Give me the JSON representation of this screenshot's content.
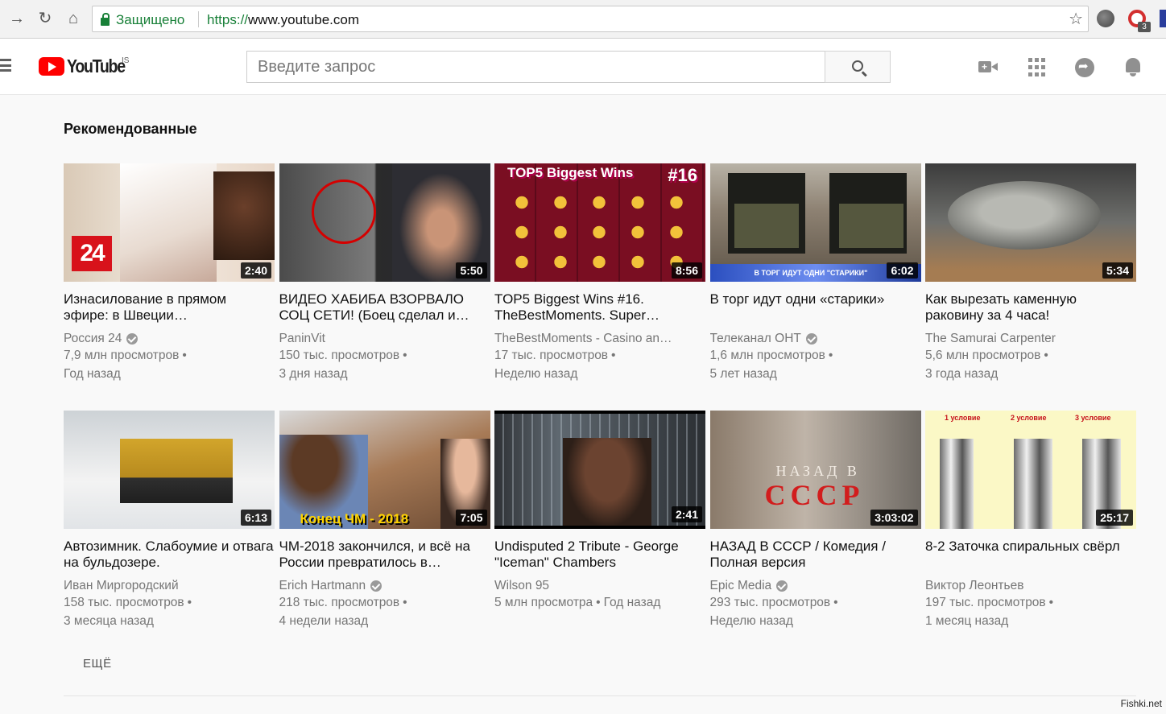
{
  "browser": {
    "secure_label": "Защищено",
    "url_protocol": "https://",
    "url_host": "www.youtube.com",
    "extension_badge": "3"
  },
  "header": {
    "logo_text": "YouTube",
    "country_code": "IS",
    "search_placeholder": "Введите запрос"
  },
  "section": {
    "title": "Рекомендованные",
    "more_label": "ЕЩЁ"
  },
  "videos": [
    {
      "title": "Изнасилование в прямом эфире: в Швеции…",
      "channel": "Россия 24",
      "verified": true,
      "views": "7,9 млн просмотров",
      "age": "Год назад",
      "duration": "2:40",
      "thumb_text": "24"
    },
    {
      "title": "ВИДЕО ХАБИБА ВЗОРВАЛО СОЦ СЕТИ! (Боец сделал и…",
      "channel": "PaninVit",
      "verified": false,
      "views": "150 тыс. просмотров",
      "age": "3 дня назад",
      "duration": "5:50"
    },
    {
      "title": "TOP5 Biggest Wins #16. TheBestMoments. Super…",
      "channel": "TheBestMoments - Casino an…",
      "verified": false,
      "views": "17 тыс. просмотров",
      "age": "Неделю назад",
      "duration": "8:56",
      "thumb_text": "TOP5 Biggest Wins",
      "thumb_num": "#16"
    },
    {
      "title": "В торг идут одни «старики»",
      "channel": "Телеканал ОНТ",
      "verified": true,
      "views": "1,6 млн просмотров",
      "age": "5 лет назад",
      "duration": "6:02",
      "thumb_text": "В ТОРГ ИДУТ ОДНИ \"СТАРИКИ\""
    },
    {
      "title": "Как вырезать каменную раковину за 4 часа!",
      "channel": "The Samurai Carpenter",
      "verified": false,
      "views": "5,6 млн просмотров",
      "age": "3 года назад",
      "duration": "5:34"
    },
    {
      "title": "Автозимник. Слабоумие и отвага на бульдозере.",
      "channel": "Иван Миргородский",
      "verified": false,
      "views": "158 тыс. просмотров",
      "age": "3 месяца назад",
      "duration": "6:13"
    },
    {
      "title": "ЧМ-2018 закончился, и всё на России превратилось в…",
      "channel": "Erich Hartmann",
      "verified": true,
      "views": "218 тыс. просмотров",
      "age": "4 недели назад",
      "duration": "7:05",
      "thumb_text": "Конец ЧМ - 2018"
    },
    {
      "title": "Undisputed 2 Tribute - George \"Iceman\" Chambers",
      "channel": "Wilson 95",
      "verified": false,
      "views": "5 млн просмотра",
      "age": "Год назад",
      "duration": "2:41",
      "inline_age": true
    },
    {
      "title": "НАЗАД В СССР / Комедия / Полная версия",
      "channel": "Epic Media",
      "verified": true,
      "views": "293 тыс. просмотров",
      "age": "Неделю назад",
      "duration": "3:03:02",
      "thumb_text": "НАЗАД В",
      "thumb_text2": "СССР"
    },
    {
      "title": "8-2 Заточка спиральных свёрл",
      "channel": "Виктор Леонтьев",
      "verified": false,
      "views": "197 тыс. просмотров",
      "age": "1 месяц назад",
      "duration": "25:17",
      "thumb_labels": [
        "1 условие",
        "2 условие",
        "3 условие"
      ]
    }
  ],
  "watermark": "Fishki.net",
  "colors": {
    "brand_red": "#ff0000",
    "secure_green": "#188038",
    "meta_gray": "#767676"
  }
}
